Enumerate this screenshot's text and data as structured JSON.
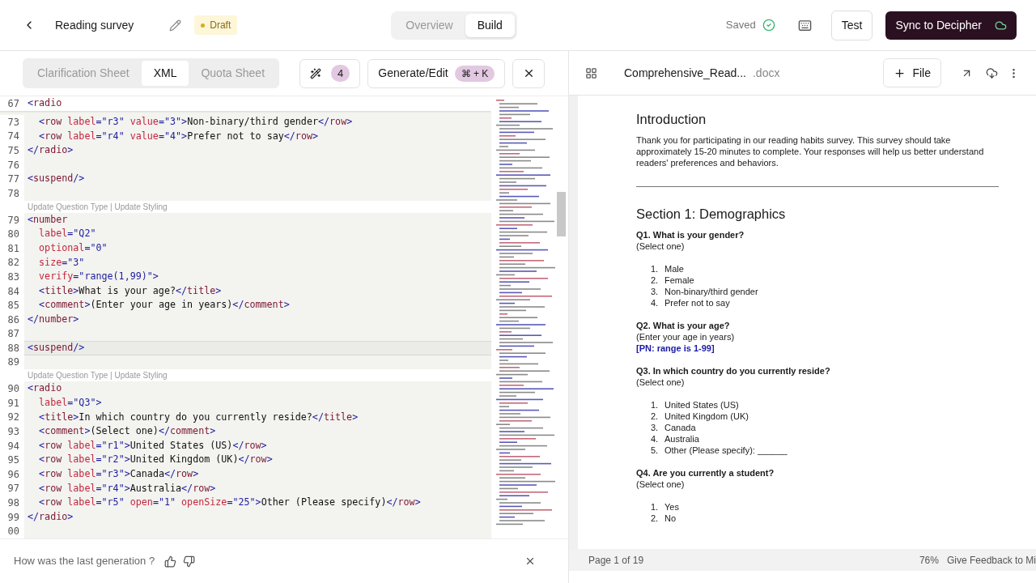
{
  "header": {
    "title": "Reading survey",
    "status_badge": "Draft",
    "views": [
      {
        "label": "Overview",
        "selected": false
      },
      {
        "label": "Build",
        "selected": true
      }
    ],
    "save_status": "Saved",
    "test_button": "Test",
    "sync_button": "Sync to Decipher"
  },
  "editor": {
    "sheet_tabs": [
      {
        "label": "Clarification Sheet",
        "selected": false
      },
      {
        "label": "XML",
        "selected": true
      },
      {
        "label": "Quota Sheet",
        "selected": false
      }
    ],
    "suggestion_count": "4",
    "generate_button": "Generate/Edit",
    "shortcut": "⌘ + K",
    "sticky_line": {
      "number": "67",
      "tokens": [
        {
          "kind": "p",
          "text": "<"
        },
        {
          "kind": "t",
          "text": "radio"
        }
      ]
    },
    "lines": [
      {
        "kind": "code",
        "number": "73",
        "current": false,
        "tokens": [
          {
            "kind": "p",
            "text": "  <"
          },
          {
            "kind": "t",
            "text": "row"
          },
          {
            "kind": "a",
            "text": " label"
          },
          {
            "kind": "p",
            "text": "="
          },
          {
            "kind": "v",
            "text": "\"r3\""
          },
          {
            "kind": "a",
            "text": " value"
          },
          {
            "kind": "p",
            "text": "="
          },
          {
            "kind": "v",
            "text": "\"3\""
          },
          {
            "kind": "p",
            "text": ">"
          },
          {
            "kind": "x",
            "text": "Non-binary/third gender"
          },
          {
            "kind": "p",
            "text": "</"
          },
          {
            "kind": "t",
            "text": "row"
          },
          {
            "kind": "p",
            "text": ">"
          }
        ]
      },
      {
        "kind": "code",
        "number": "74",
        "current": false,
        "tokens": [
          {
            "kind": "p",
            "text": "  <"
          },
          {
            "kind": "t",
            "text": "row"
          },
          {
            "kind": "a",
            "text": " label"
          },
          {
            "kind": "p",
            "text": "="
          },
          {
            "kind": "v",
            "text": "\"r4\""
          },
          {
            "kind": "a",
            "text": " value"
          },
          {
            "kind": "p",
            "text": "="
          },
          {
            "kind": "v",
            "text": "\"4\""
          },
          {
            "kind": "p",
            "text": ">"
          },
          {
            "kind": "x",
            "text": "Prefer not to say"
          },
          {
            "kind": "p",
            "text": "</"
          },
          {
            "kind": "t",
            "text": "row"
          },
          {
            "kind": "p",
            "text": ">"
          }
        ]
      },
      {
        "kind": "code",
        "number": "75",
        "current": false,
        "tokens": [
          {
            "kind": "p",
            "text": "</"
          },
          {
            "kind": "t",
            "text": "radio"
          },
          {
            "kind": "p",
            "text": ">"
          }
        ]
      },
      {
        "kind": "code",
        "number": "76",
        "current": false
      },
      {
        "kind": "code",
        "number": "77",
        "current": false,
        "tokens": [
          {
            "kind": "p",
            "text": "<"
          },
          {
            "kind": "t",
            "text": "suspend"
          },
          {
            "kind": "p",
            "text": "/>"
          }
        ]
      },
      {
        "kind": "code",
        "number": "78",
        "current": false
      },
      {
        "kind": "lens",
        "text": "Update Question Type | Update Styling"
      },
      {
        "kind": "code",
        "number": "79",
        "current": false,
        "tokens": [
          {
            "kind": "p",
            "text": "<"
          },
          {
            "kind": "t",
            "text": "number"
          }
        ]
      },
      {
        "kind": "code",
        "number": "80",
        "current": false,
        "tokens": [
          {
            "kind": "a",
            "text": "  label"
          },
          {
            "kind": "p",
            "text": "="
          },
          {
            "kind": "v",
            "text": "\"Q2\""
          }
        ]
      },
      {
        "kind": "code",
        "number": "81",
        "current": false,
        "tokens": [
          {
            "kind": "a",
            "text": "  optional"
          },
          {
            "kind": "p",
            "text": "="
          },
          {
            "kind": "v",
            "text": "\"0\""
          }
        ]
      },
      {
        "kind": "code",
        "number": "82",
        "current": false,
        "tokens": [
          {
            "kind": "a",
            "text": "  size"
          },
          {
            "kind": "p",
            "text": "="
          },
          {
            "kind": "v",
            "text": "\"3\""
          }
        ]
      },
      {
        "kind": "code",
        "number": "83",
        "current": false,
        "tokens": [
          {
            "kind": "a",
            "text": "  verify"
          },
          {
            "kind": "p",
            "text": "="
          },
          {
            "kind": "v",
            "text": "\"range(1,99)\""
          },
          {
            "kind": "p",
            "text": ">"
          }
        ]
      },
      {
        "kind": "code",
        "number": "84",
        "current": false,
        "tokens": [
          {
            "kind": "p",
            "text": "  <"
          },
          {
            "kind": "t",
            "text": "title"
          },
          {
            "kind": "p",
            "text": ">"
          },
          {
            "kind": "x",
            "text": "What is your age?"
          },
          {
            "kind": "p",
            "text": "</"
          },
          {
            "kind": "t",
            "text": "title"
          },
          {
            "kind": "p",
            "text": ">"
          }
        ]
      },
      {
        "kind": "code",
        "number": "85",
        "current": false,
        "tokens": [
          {
            "kind": "p",
            "text": "  <"
          },
          {
            "kind": "t",
            "text": "comment"
          },
          {
            "kind": "p",
            "text": ">"
          },
          {
            "kind": "x",
            "text": "(Enter your age in years)"
          },
          {
            "kind": "p",
            "text": "</"
          },
          {
            "kind": "t",
            "text": "comment"
          },
          {
            "kind": "p",
            "text": ">"
          }
        ]
      },
      {
        "kind": "code",
        "number": "86",
        "current": false,
        "tokens": [
          {
            "kind": "p",
            "text": "</"
          },
          {
            "kind": "t",
            "text": "number"
          },
          {
            "kind": "p",
            "text": ">"
          }
        ]
      },
      {
        "kind": "code",
        "number": "87",
        "current": false
      },
      {
        "kind": "code",
        "number": "88",
        "current": true,
        "tokens": [
          {
            "kind": "p",
            "text": "<"
          },
          {
            "kind": "t",
            "text": "suspend"
          },
          {
            "kind": "p",
            "text": "/>"
          }
        ]
      },
      {
        "kind": "code",
        "number": "89",
        "current": false
      },
      {
        "kind": "lens",
        "text": "Update Question Type | Update Styling"
      },
      {
        "kind": "code",
        "number": "90",
        "current": false,
        "tokens": [
          {
            "kind": "p",
            "text": "<"
          },
          {
            "kind": "t",
            "text": "radio"
          }
        ]
      },
      {
        "kind": "code",
        "number": "91",
        "current": false,
        "tokens": [
          {
            "kind": "a",
            "text": "  label"
          },
          {
            "kind": "p",
            "text": "="
          },
          {
            "kind": "v",
            "text": "\"Q3\""
          },
          {
            "kind": "p",
            "text": ">"
          }
        ]
      },
      {
        "kind": "code",
        "number": "92",
        "current": false,
        "tokens": [
          {
            "kind": "p",
            "text": "  <"
          },
          {
            "kind": "t",
            "text": "title"
          },
          {
            "kind": "p",
            "text": ">"
          },
          {
            "kind": "x",
            "text": "In which country do you currently reside?"
          },
          {
            "kind": "p",
            "text": "</"
          },
          {
            "kind": "t",
            "text": "title"
          },
          {
            "kind": "p",
            "text": ">"
          }
        ]
      },
      {
        "kind": "code",
        "number": "93",
        "current": false,
        "tokens": [
          {
            "kind": "p",
            "text": "  <"
          },
          {
            "kind": "t",
            "text": "comment"
          },
          {
            "kind": "p",
            "text": ">"
          },
          {
            "kind": "x",
            "text": "(Select one)"
          },
          {
            "kind": "p",
            "text": "</"
          },
          {
            "kind": "t",
            "text": "comment"
          },
          {
            "kind": "p",
            "text": ">"
          }
        ]
      },
      {
        "kind": "code",
        "number": "94",
        "current": false,
        "tokens": [
          {
            "kind": "p",
            "text": "  <"
          },
          {
            "kind": "t",
            "text": "row"
          },
          {
            "kind": "a",
            "text": " label"
          },
          {
            "kind": "p",
            "text": "="
          },
          {
            "kind": "v",
            "text": "\"r1\""
          },
          {
            "kind": "p",
            "text": ">"
          },
          {
            "kind": "x",
            "text": "United States (US)"
          },
          {
            "kind": "p",
            "text": "</"
          },
          {
            "kind": "t",
            "text": "row"
          },
          {
            "kind": "p",
            "text": ">"
          }
        ]
      },
      {
        "kind": "code",
        "number": "95",
        "current": false,
        "tokens": [
          {
            "kind": "p",
            "text": "  <"
          },
          {
            "kind": "t",
            "text": "row"
          },
          {
            "kind": "a",
            "text": " label"
          },
          {
            "kind": "p",
            "text": "="
          },
          {
            "kind": "v",
            "text": "\"r2\""
          },
          {
            "kind": "p",
            "text": ">"
          },
          {
            "kind": "x",
            "text": "United Kingdom (UK)"
          },
          {
            "kind": "p",
            "text": "</"
          },
          {
            "kind": "t",
            "text": "row"
          },
          {
            "kind": "p",
            "text": ">"
          }
        ]
      },
      {
        "kind": "code",
        "number": "96",
        "current": false,
        "tokens": [
          {
            "kind": "p",
            "text": "  <"
          },
          {
            "kind": "t",
            "text": "row"
          },
          {
            "kind": "a",
            "text": " label"
          },
          {
            "kind": "p",
            "text": "="
          },
          {
            "kind": "v",
            "text": "\"r3\""
          },
          {
            "kind": "p",
            "text": ">"
          },
          {
            "kind": "x",
            "text": "Canada"
          },
          {
            "kind": "p",
            "text": "</"
          },
          {
            "kind": "t",
            "text": "row"
          },
          {
            "kind": "p",
            "text": ">"
          }
        ]
      },
      {
        "kind": "code",
        "number": "97",
        "current": false,
        "tokens": [
          {
            "kind": "p",
            "text": "  <"
          },
          {
            "kind": "t",
            "text": "row"
          },
          {
            "kind": "a",
            "text": " label"
          },
          {
            "kind": "p",
            "text": "="
          },
          {
            "kind": "v",
            "text": "\"r4\""
          },
          {
            "kind": "p",
            "text": ">"
          },
          {
            "kind": "x",
            "text": "Australia"
          },
          {
            "kind": "p",
            "text": "</"
          },
          {
            "kind": "t",
            "text": "row"
          },
          {
            "kind": "p",
            "text": ">"
          }
        ]
      },
      {
        "kind": "code",
        "number": "98",
        "current": false,
        "tokens": [
          {
            "kind": "p",
            "text": "  <"
          },
          {
            "kind": "t",
            "text": "row"
          },
          {
            "kind": "a",
            "text": " label"
          },
          {
            "kind": "p",
            "text": "="
          },
          {
            "kind": "v",
            "text": "\"r5\""
          },
          {
            "kind": "a",
            "text": " open"
          },
          {
            "kind": "p",
            "text": "="
          },
          {
            "kind": "v",
            "text": "\"1\""
          },
          {
            "kind": "a",
            "text": " openSize"
          },
          {
            "kind": "p",
            "text": "="
          },
          {
            "kind": "v",
            "text": "\"25\""
          },
          {
            "kind": "p",
            "text": ">"
          },
          {
            "kind": "x",
            "text": "Other (Please specify)"
          },
          {
            "kind": "p",
            "text": "</"
          },
          {
            "kind": "t",
            "text": "row"
          },
          {
            "kind": "p",
            "text": ">"
          }
        ]
      },
      {
        "kind": "code",
        "number": "99",
        "current": false,
        "tokens": [
          {
            "kind": "p",
            "text": "</"
          },
          {
            "kind": "t",
            "text": "radio"
          },
          {
            "kind": "p",
            "text": ">"
          }
        ]
      },
      {
        "kind": "code",
        "number": "00",
        "current": false
      }
    ],
    "feedback_prompt": "How was the last generation ?"
  },
  "document": {
    "file_name": "Comprehensive_Read...",
    "extension": ".docx",
    "add_file_button": "File",
    "blocks": [
      {
        "kind": "heading",
        "text": "Introduction"
      },
      {
        "kind": "paragraph",
        "text": "Thank you for participating in our reading habits survey. This survey should take approximately 15-20 minutes to complete. Your responses will help us better understand readers' preferences and behaviors."
      },
      {
        "kind": "rule"
      },
      {
        "kind": "heading",
        "text": "Section 1: Demographics"
      },
      {
        "kind": "question",
        "title": "Q1. What is your gender?",
        "comment": "(Select one)",
        "options": [
          {
            "number": "1.",
            "text": "Male"
          },
          {
            "number": "2.",
            "text": "Female"
          },
          {
            "number": "3.",
            "text": "Non-binary/third gender"
          },
          {
            "number": "4.",
            "text": "Prefer not to say"
          }
        ]
      },
      {
        "kind": "question",
        "title": "Q2. What is your age?",
        "comment": "(Enter your age in years)",
        "note": "[PN: range is 1-99]"
      },
      {
        "kind": "question",
        "title": "Q3. In which country do you currently reside?",
        "comment": "(Select one)",
        "options": [
          {
            "number": "1.",
            "text": "United States (US)"
          },
          {
            "number": "2.",
            "text": "United Kingdom (UK)"
          },
          {
            "number": "3.",
            "text": "Canada"
          },
          {
            "number": "4.",
            "text": "Australia"
          },
          {
            "number": "5.",
            "text": "Other (Please specify): ______"
          }
        ]
      },
      {
        "kind": "question",
        "title": "Q4. Are you currently a student?",
        "comment": "(Select one)",
        "options": [
          {
            "number": "1.",
            "text": "Yes"
          },
          {
            "number": "2.",
            "text": "No"
          }
        ]
      }
    ],
    "status_bar": {
      "page": "Page 1 of 19",
      "zoom": "76%",
      "feedback": "Give Feedback to Mi"
    }
  }
}
